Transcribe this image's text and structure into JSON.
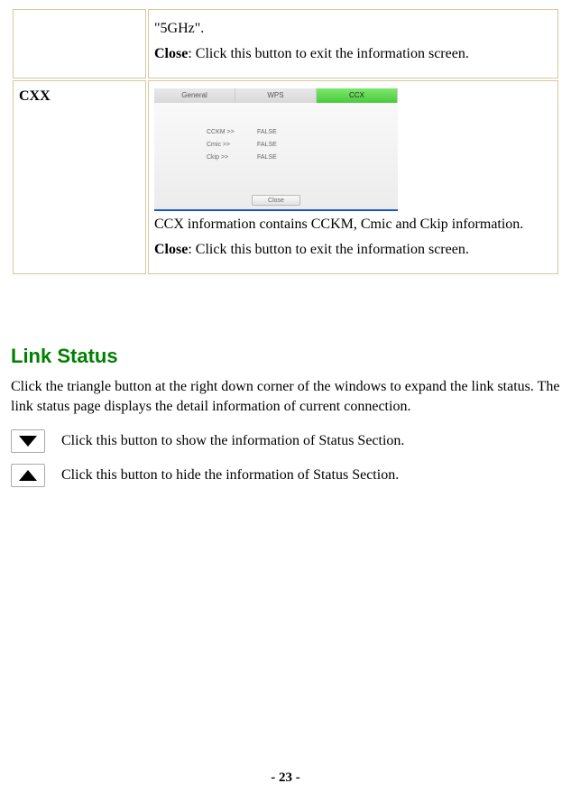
{
  "table": {
    "row1": {
      "left": "",
      "r1_line1": "\"5GHz\".",
      "r1_close_label": "Close",
      "r1_close_text": ": Click this button to exit the information screen."
    },
    "row2": {
      "left": "CXX",
      "tabs": {
        "general": "General",
        "wps": "WPS",
        "ccx": "CCX"
      },
      "rows": {
        "r0k": "CCKM >>",
        "r0v": "FALSE",
        "r1k": "Cmic >>",
        "r1v": "FALSE",
        "r2k": "Ckip >>",
        "r2v": "FALSE"
      },
      "close_btn": "Close",
      "r2_para": "CCX information contains CCKM, Cmic and Ckip information.",
      "r2_close_label": "Close",
      "r2_close_text": ": Click this button to exit the information screen."
    }
  },
  "section": {
    "title": "Link Status",
    "intro": "Click the triangle button at the right down corner of the windows to expand the link status. The link status page displays the detail information of current connection.",
    "btn_show": "Click this button to show the information of Status Section.",
    "btn_hide": "Click this button to hide the information of Status Section."
  },
  "page_number": "- 23 -"
}
